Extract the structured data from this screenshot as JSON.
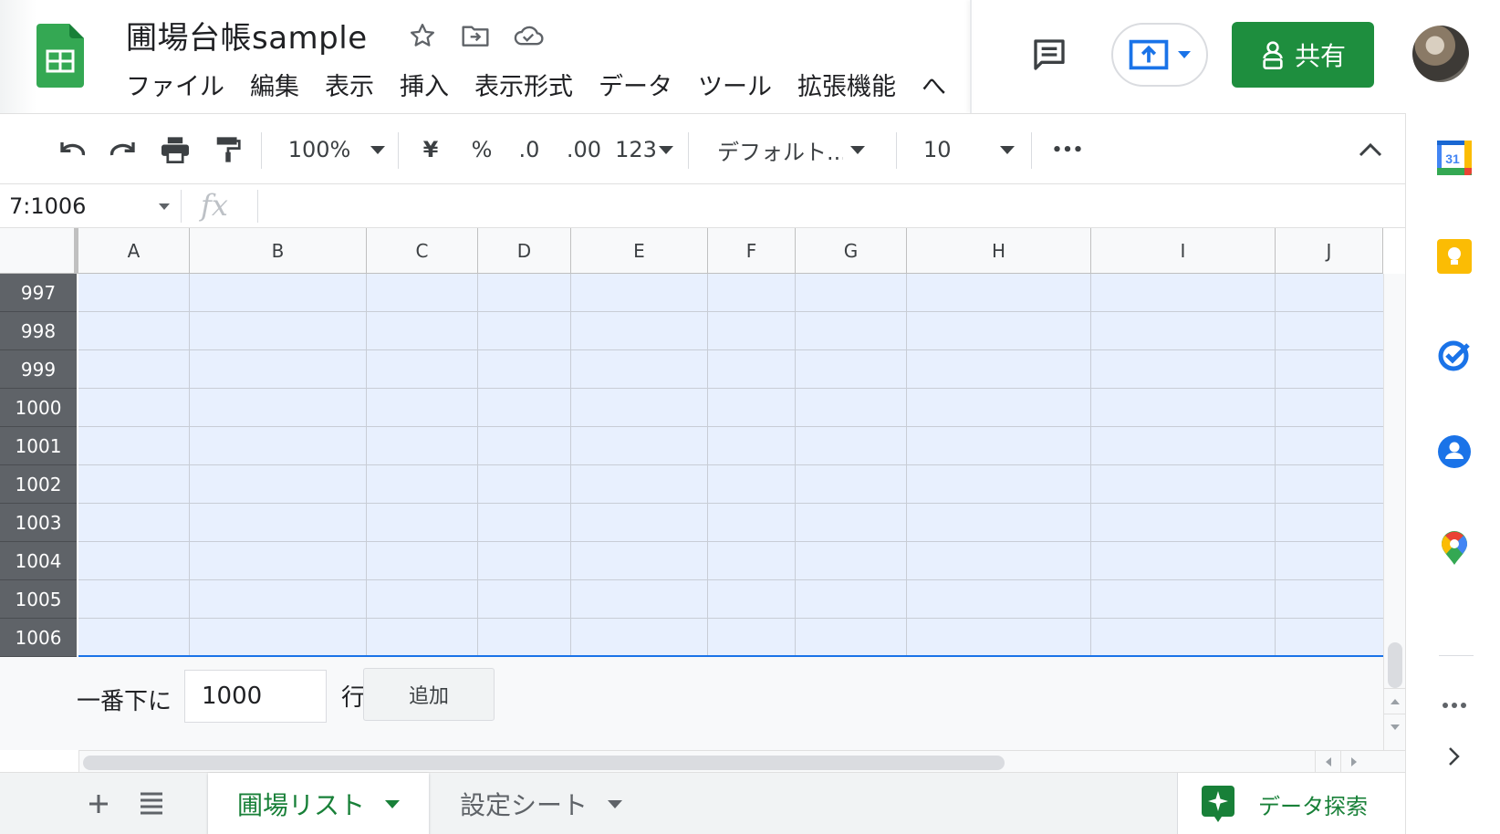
{
  "app": {
    "title": "圃場台帳sample",
    "menu": [
      "ファイル",
      "編集",
      "表示",
      "挿入",
      "表示形式",
      "データ",
      "ツール",
      "拡張機能",
      "へ"
    ],
    "share_label": "共有"
  },
  "toolbar": {
    "zoom": "100%",
    "currency": "¥",
    "percent": "%",
    "decrease_decimal": ".0",
    "increase_decimal": ".00",
    "more_formats": "123",
    "font": "デフォルト...",
    "font_size": "10",
    "more": "•••"
  },
  "formula_bar": {
    "name_box": "7:1006",
    "fx": "fx",
    "content": ""
  },
  "grid": {
    "columns": [
      "A",
      "B",
      "C",
      "D",
      "E",
      "F",
      "G",
      "H",
      "I",
      "J"
    ],
    "rows": [
      "997",
      "998",
      "999",
      "1000",
      "1001",
      "1002",
      "1003",
      "1004",
      "1005",
      "1006"
    ]
  },
  "add_rows": {
    "label": "一番下に",
    "value": "1000",
    "unit": "行",
    "button": "追加"
  },
  "sheets": {
    "tabs": [
      {
        "label": "圃場リスト",
        "active": true
      },
      {
        "label": "設定シート",
        "active": false
      }
    ],
    "explore_label": "データ探索"
  },
  "side_panel": {
    "calendar_day": "31",
    "icons": [
      "calendar-icon",
      "keep-icon",
      "tasks-icon",
      "contacts-icon",
      "maps-icon",
      "more-icon",
      "expand-icon"
    ]
  },
  "colors": {
    "accent_green": "#1e8e3e",
    "selection": "#e8f0fe",
    "selection_border": "#1a73e8"
  }
}
